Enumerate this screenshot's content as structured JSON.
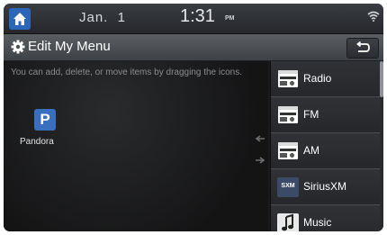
{
  "status_bar": {
    "date": "Jan.  1",
    "time": "1:31",
    "ampm": "PM"
  },
  "title_bar": {
    "title": "Edit My Menu"
  },
  "instructions": "You can add, delete, or move items by dragging the icons.",
  "available_items": [
    {
      "icon": "pandora-icon",
      "icon_letter": "P",
      "label": "Pandora"
    }
  ],
  "my_menu": [
    {
      "icon": "radio-icon",
      "label": "Radio"
    },
    {
      "icon": "radio-icon",
      "label": "FM"
    },
    {
      "icon": "radio-icon",
      "label": "AM"
    },
    {
      "icon": "siriusxm-icon",
      "icon_text": "SXM",
      "label": "SiriusXM"
    },
    {
      "icon": "music-note-icon",
      "label": "Music"
    }
  ],
  "colors": {
    "accent_blue": "#2c66b9",
    "pandora_blue": "#3a6fbf",
    "background": "#1a1a1b"
  }
}
